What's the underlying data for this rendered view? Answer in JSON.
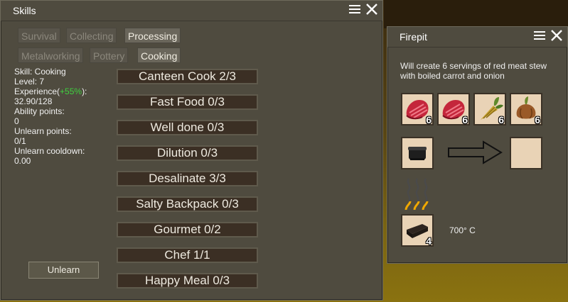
{
  "skills_window": {
    "title": "Skills",
    "tabs": [
      {
        "label": "Survival",
        "active": false
      },
      {
        "label": "Collecting",
        "active": false
      },
      {
        "label": "Processing",
        "active": true
      },
      {
        "label": "Metalworking",
        "active": false
      },
      {
        "label": "Pottery",
        "active": false
      },
      {
        "label": "Cooking",
        "active": true
      }
    ],
    "info": {
      "skill": "Skill: Cooking",
      "level": "Level: 7",
      "experience_label": "Experience(",
      "experience_bonus": "+55%",
      "experience_close": "):",
      "experience_value": "32.90/128",
      "ability_points_label": "Ability points:",
      "ability_points": "0",
      "unlearn_points_label": "Unlearn points:",
      "unlearn_points": "0/1",
      "unlearn_cooldown_label": "Unlearn cooldown:",
      "unlearn_cooldown": "0.00"
    },
    "abilities": [
      "Canteen Cook 2/3",
      "Fast Food 0/3",
      "Well done 0/3",
      "Dilution 0/3",
      "Desalinate 3/3",
      "Salty Backpack 0/3",
      "Gourmet 0/2",
      "Chef 1/1",
      "Happy Meal 0/3"
    ],
    "unlearn_label": "Unlearn"
  },
  "firepit_window": {
    "title": "Firepit",
    "description": "Will create 6 servings of red meat stew with boiled carrot and onion",
    "ingredients": [
      {
        "icon": "red-meat-icon",
        "qty": "6"
      },
      {
        "icon": "red-meat-icon",
        "qty": "6"
      },
      {
        "icon": "carrot-icon",
        "qty": "6"
      },
      {
        "icon": "onion-icon",
        "qty": "6"
      }
    ],
    "pot_icon": "cooking-pot-icon",
    "output_icon": "empty-slot",
    "fuel": {
      "icon": "charcoal-icon",
      "qty": "4"
    },
    "temperature": "700° C"
  }
}
